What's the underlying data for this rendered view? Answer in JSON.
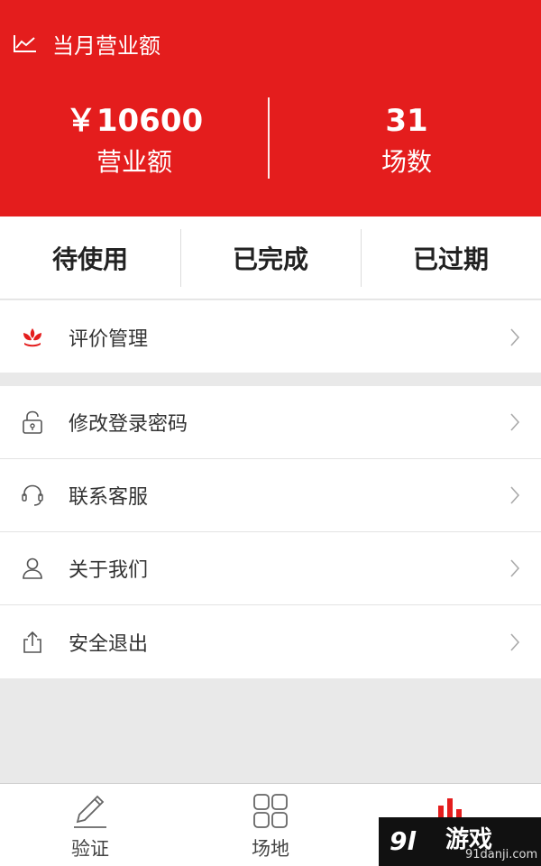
{
  "header": {
    "title": "当月营业额",
    "icon": "trend-line-icon",
    "revenue_value": "￥10600",
    "revenue_label": "营业额",
    "sessions_value": "31",
    "sessions_label": "场数",
    "color": "#e41d1d"
  },
  "tabs": [
    {
      "label": "待使用"
    },
    {
      "label": "已完成"
    },
    {
      "label": "已过期"
    }
  ],
  "menu_primary": [
    {
      "label": "评价管理",
      "icon": "flower-icon",
      "icon_color": "#e41d1d"
    }
  ],
  "menu_secondary": [
    {
      "label": "修改登录密码",
      "icon": "lock-icon"
    },
    {
      "label": "联系客服",
      "icon": "headset-icon"
    },
    {
      "label": "关于我们",
      "icon": "user-icon"
    },
    {
      "label": "安全退出",
      "icon": "share-exit-icon"
    }
  ],
  "tabbar": [
    {
      "label": "验证",
      "icon": "pen-icon"
    },
    {
      "label": "场地",
      "icon": "grid-icon"
    },
    {
      "label": "",
      "icon": "bar-chart-icon",
      "active": true
    }
  ],
  "watermark": {
    "logo": "9l",
    "main": "游戏",
    "sub": "91danji.com"
  }
}
